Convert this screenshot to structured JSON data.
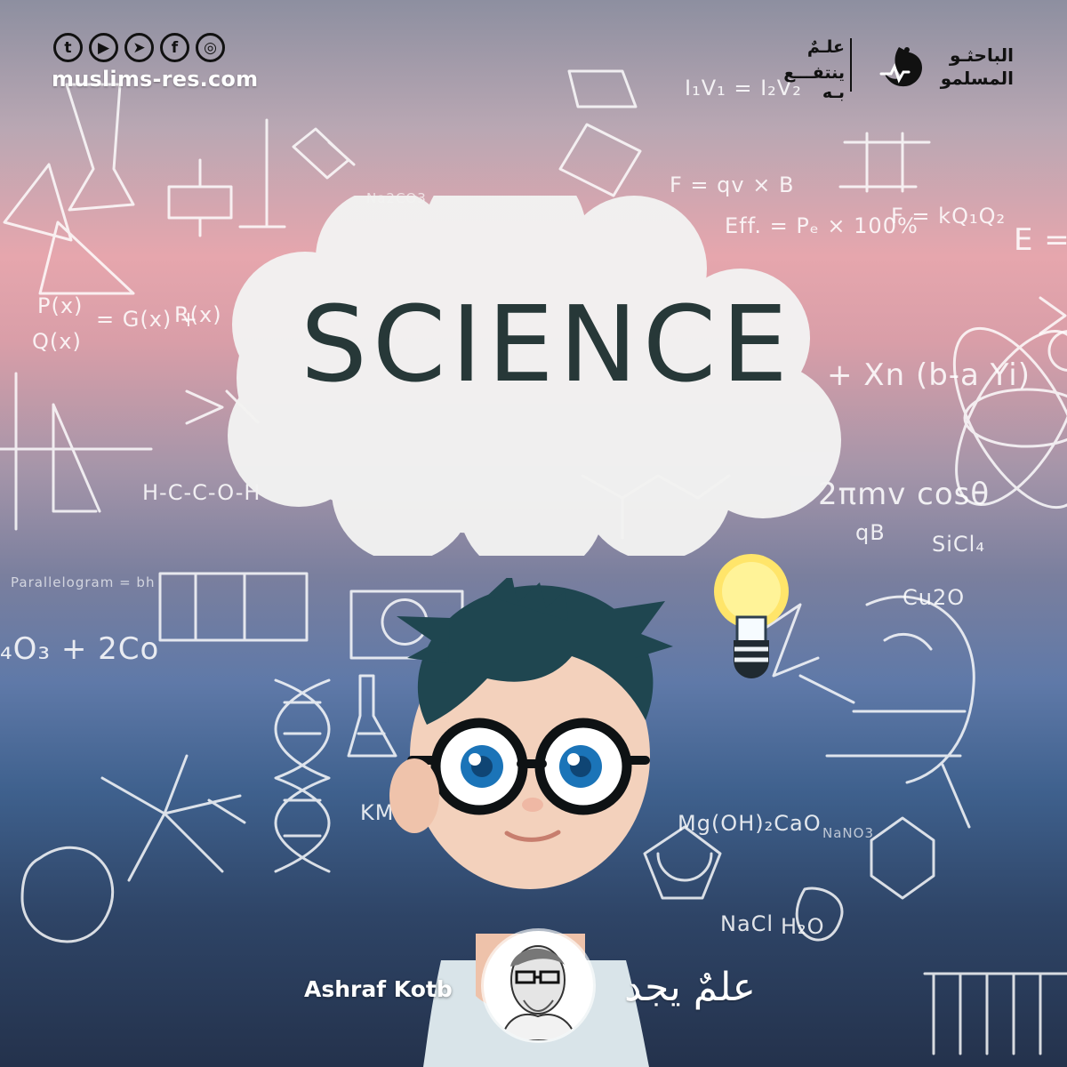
{
  "header": {
    "social_icons": [
      {
        "icon": "twitter-icon",
        "glyph": "t"
      },
      {
        "icon": "youtube-icon",
        "glyph": "▶"
      },
      {
        "icon": "telegram-icon",
        "glyph": "➤"
      },
      {
        "icon": "facebook-icon",
        "glyph": "f"
      },
      {
        "icon": "instagram-icon",
        "glyph": "◎"
      }
    ],
    "site_url": "muslims-res.com",
    "brand": {
      "tagline_line1": "علـمٌ",
      "tagline_line2": "ينتفـــع بـه",
      "name_line1": "الباحثـو",
      "name_line2": "المسلمو"
    }
  },
  "hero": {
    "title": "SCIENCE"
  },
  "chalkboard": {
    "formulas": [
      "I₁V₁ = I₂V₂",
      "F = qv × B",
      "Eff. = Pₑ × 100%",
      "F = kQ₁Q₂",
      "E =",
      "P(x)",
      "Q(x)",
      "= G(x) +",
      "R(x)",
      "+ Xn (b-a Yi)",
      "H-C-C-O-H",
      "2πmv cosθ",
      "qB",
      "SiCl₄",
      "Parallelogram = bh",
      "Cu2O",
      "₄O₃ + 2Co",
      "KMnO",
      "Mg(OH)₂CaO",
      "NaNO3",
      "NaCl",
      "H₂O",
      "Na2CO3"
    ]
  },
  "footer": {
    "author_name": "Ashraf Kotb",
    "series_title": "علمٌ يجد"
  },
  "colors": {
    "accent_dark": "#273838",
    "hair": "#1f4650",
    "eyes": "#1b74b8",
    "bulb": "#ffe56a"
  }
}
